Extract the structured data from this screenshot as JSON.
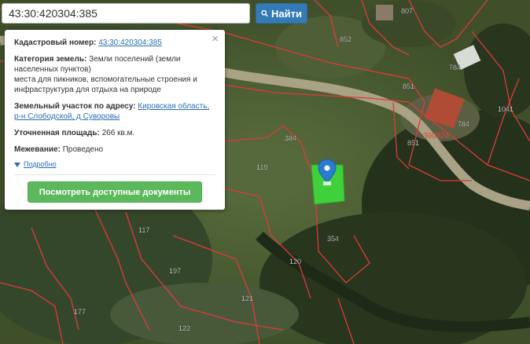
{
  "search": {
    "value": "43:30:420304:385",
    "button_label": "Найти"
  },
  "popup": {
    "cadastral_label": "Кадастровый номер:",
    "cadastral_value": "43:30:420304:385",
    "category_label": "Категория земель:",
    "category_value": "Земли поселений (земли населенных пунктов)",
    "category_detail": "места для пикников, вспомогательные строения и инфраструктура для отдыха на природе",
    "address_label": "Земельный участок по адресу:",
    "address_value": "Кировская область, р-н Слободской, д Суворовы",
    "area_label": "Уточненная площадь:",
    "area_value": "266 кв.м.",
    "survey_label": "Межевание:",
    "survey_value": "Проведено",
    "details_label": "Подробно",
    "documents_button": "Посмотреть доступные документы",
    "close_symbol": "×"
  },
  "map": {
    "parcel_labels": [
      "807",
      "852",
      "851",
      "784",
      "784",
      "1041",
      "851",
      "384",
      "119",
      "117",
      "354",
      "120",
      "197",
      "121",
      "177",
      "122",
      "390924"
    ]
  },
  "colors": {
    "parcel_border": "#e03a3a",
    "selected_parcel": "#3ddc3d",
    "marker": "#2a7bd2",
    "search_button": "#337ab7",
    "docs_button": "#5cb85c"
  }
}
